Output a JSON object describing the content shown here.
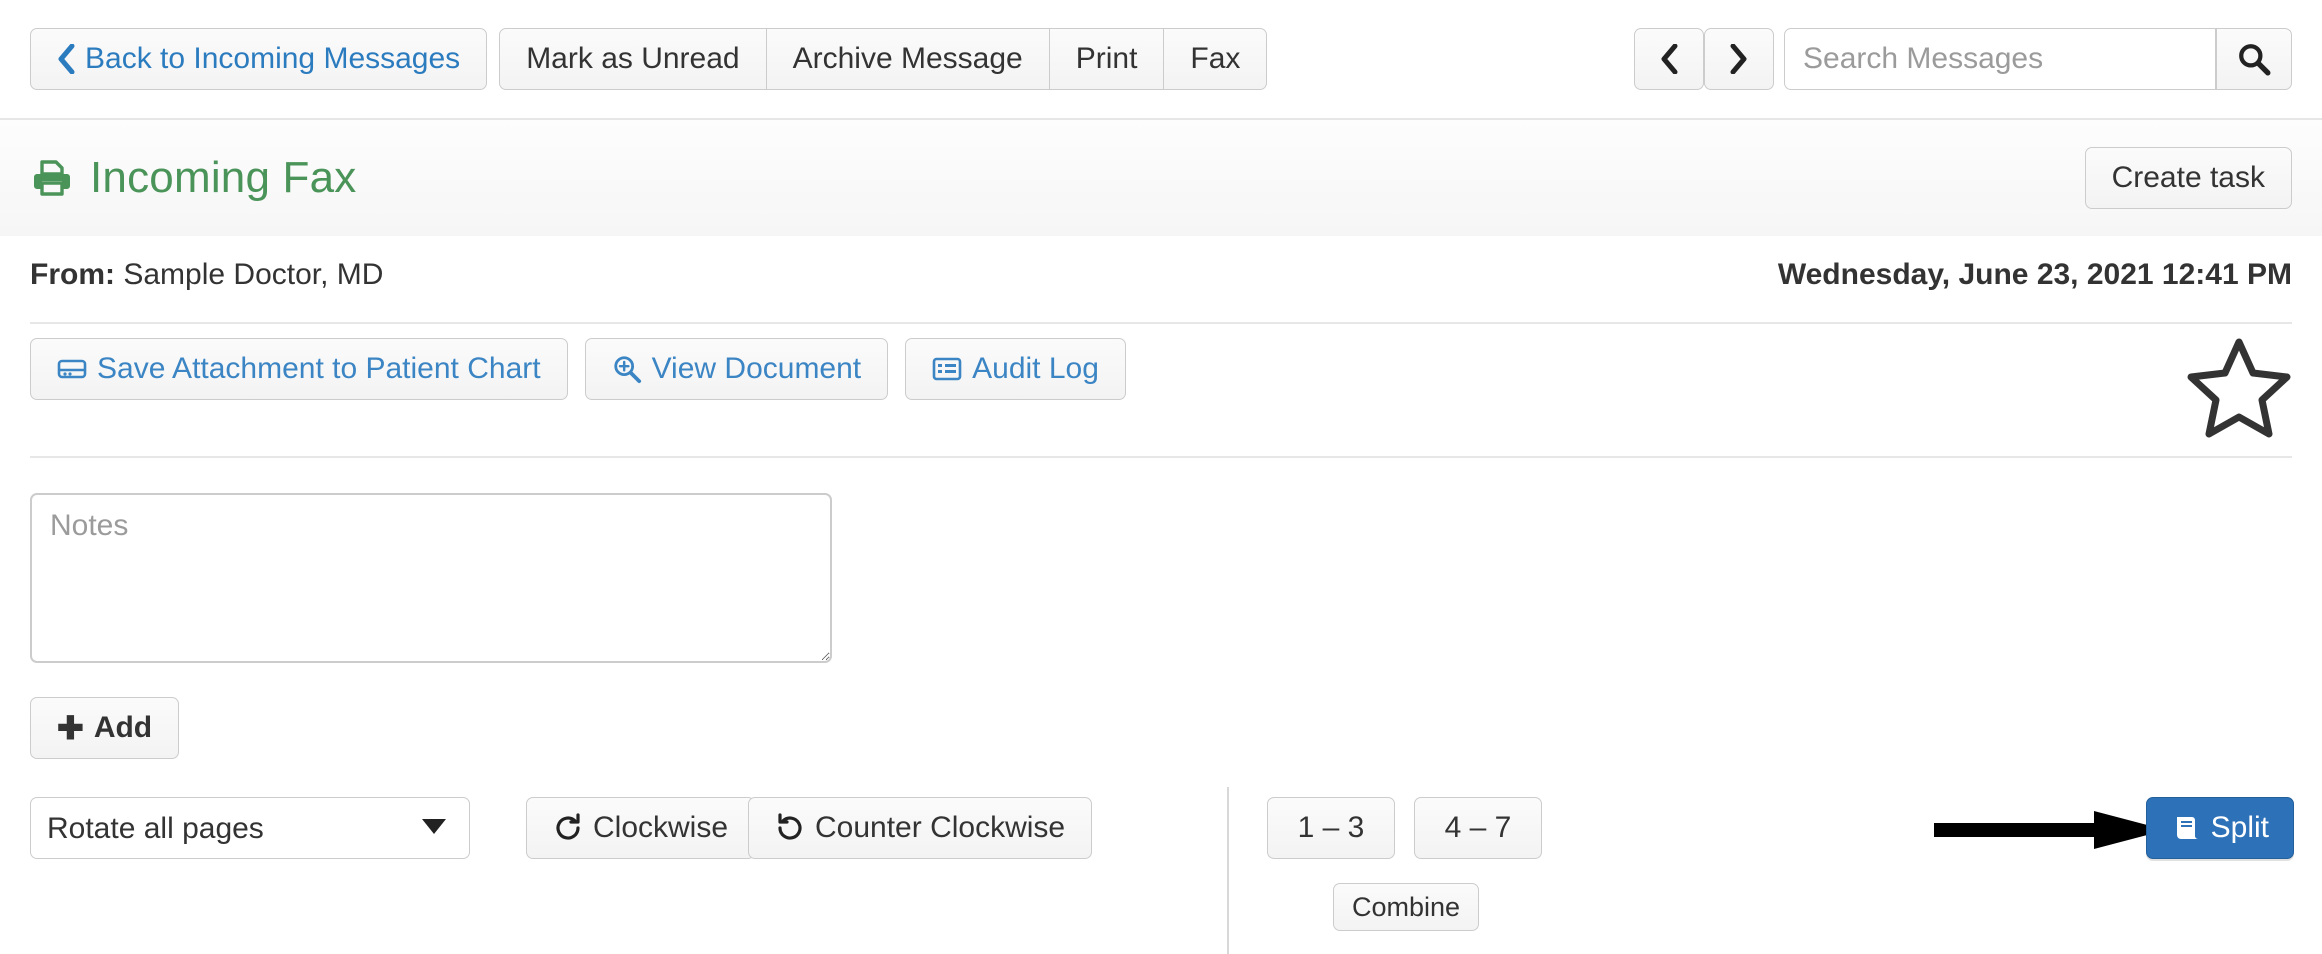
{
  "toolbar": {
    "back_label": "Back to Incoming Messages",
    "back_icon": "chevron-left-icon",
    "group": [
      {
        "label": "Mark as Unread",
        "name": "mark-as-unread-button"
      },
      {
        "label": "Archive Message",
        "name": "archive-message-button"
      },
      {
        "label": "Print",
        "name": "print-button"
      },
      {
        "label": "Fax",
        "name": "fax-button"
      }
    ],
    "prev_icon": "chevron-left-icon",
    "next_icon": "chevron-right-icon",
    "search_placeholder": "Search Messages",
    "search_value": "",
    "search_icon": "search-icon"
  },
  "header": {
    "title": "Incoming Fax",
    "title_icon": "fax-printer-icon",
    "title_color": "#4a9459",
    "create_task_label": "Create task"
  },
  "message": {
    "from_label": "From:",
    "from_value": "Sample Doctor, MD",
    "date": "Wednesday, June 23, 2021 12:41 PM",
    "star_icon": "star-outline-icon"
  },
  "actions": [
    {
      "label": "Save Attachment to Patient Chart",
      "icon": "save-icon",
      "name": "save-attachment-to-patient-chart-button"
    },
    {
      "label": "View Document",
      "icon": "zoom-in-icon",
      "name": "view-document-button"
    },
    {
      "label": "Audit Log",
      "icon": "list-alt-icon",
      "name": "audit-log-button"
    }
  ],
  "notes": {
    "placeholder": "Notes",
    "value": "",
    "add_label": "Add",
    "add_icon": "plus-icon"
  },
  "page_tools": {
    "rotate_selected": "Rotate all pages",
    "rotate_options": [
      "Rotate all pages"
    ],
    "rotate_caret_icon": "chevron-down-icon",
    "clockwise_label": "Clockwise",
    "clockwise_icon": "rotate-cw-icon",
    "counter_clockwise_label": "Counter Clockwise",
    "counter_clockwise_icon": "rotate-ccw-icon",
    "page_ranges": [
      "1 – 3",
      "4 – 7"
    ],
    "combine_label": "Combine",
    "split_label": "Split",
    "split_icon": "book-icon",
    "split_color": "#2d72b8",
    "annotation_arrow_icon": "arrow-right-annotation"
  }
}
